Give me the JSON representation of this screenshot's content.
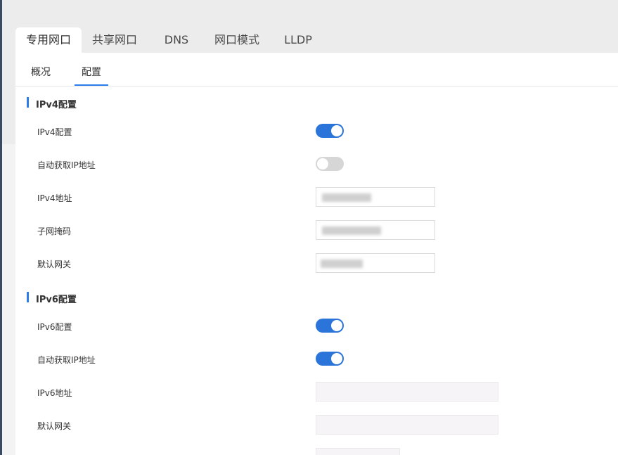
{
  "tabs": [
    {
      "label": "专用网口",
      "active": true
    },
    {
      "label": "共享网口",
      "active": false
    },
    {
      "label": "DNS",
      "active": false
    },
    {
      "label": "网口模式",
      "active": false
    },
    {
      "label": "LLDP",
      "active": false
    }
  ],
  "subtabs": [
    {
      "label": "概况",
      "active": false
    },
    {
      "label": "配置",
      "active": true
    }
  ],
  "ipv4": {
    "section_title": "IPv4配置",
    "enable_label": "IPv4配置",
    "enable_on": true,
    "dhcp_label": "自动获取IP地址",
    "dhcp_on": false,
    "address_label": "IPv4地址",
    "address_value": "",
    "mask_label": "子网掩码",
    "mask_value": "",
    "gateway_label": "默认网关",
    "gateway_value": ""
  },
  "ipv6": {
    "section_title": "IPv6配置",
    "enable_label": "IPv6配置",
    "enable_on": true,
    "dhcp_label": "自动获取IP地址",
    "dhcp_on": true,
    "address_label": "IPv6地址",
    "address_value": "",
    "gateway_label": "默认网关",
    "gateway_value": ""
  },
  "colors": {
    "accent": "#2b74d9",
    "toggle_off": "#d6d6d6"
  }
}
